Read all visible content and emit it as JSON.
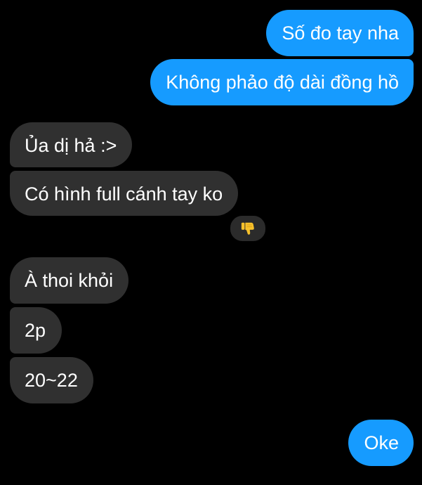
{
  "messages": [
    {
      "sender": "me",
      "text": "Số đo tay nha"
    },
    {
      "sender": "me",
      "text": "Không phảo độ dài đồng hồ"
    },
    {
      "sender": "them",
      "text": "Ủa dị hả :>"
    },
    {
      "sender": "them",
      "text": "Có hình full cánh tay ko",
      "reaction": "thumbs-down-emoji"
    },
    {
      "sender": "them",
      "text": "À thoi khỏi"
    },
    {
      "sender": "them",
      "text": "2p"
    },
    {
      "sender": "them",
      "text": "20~22"
    },
    {
      "sender": "me",
      "text": "Oke"
    }
  ],
  "colors": {
    "background": "#000000",
    "outgoing_bubble": "#169bff",
    "incoming_bubble": "#303030",
    "text": "#ffffff",
    "reaction_emoji": "#f7c12b"
  }
}
